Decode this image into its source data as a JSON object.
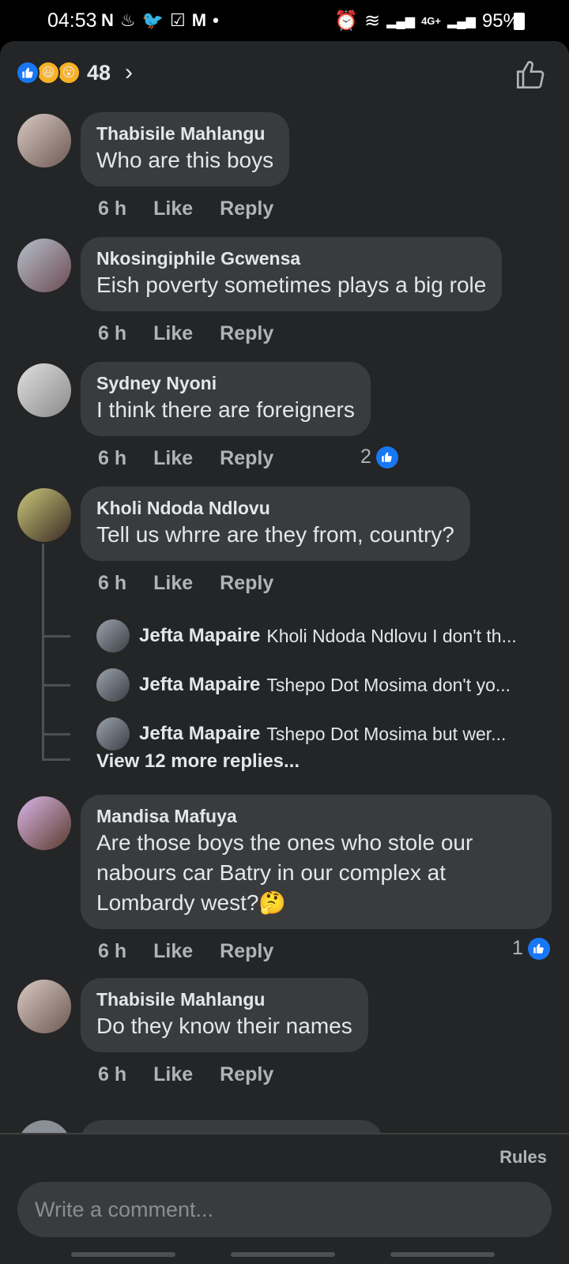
{
  "status_bar": {
    "time": "04:53",
    "left_icons": [
      "n-app-icon",
      "bell-icon",
      "twitter-icon",
      "check-icon",
      "gmail-icon",
      "dot-icon"
    ],
    "network": "4G+",
    "battery": "95%"
  },
  "reactions": {
    "types": [
      "like",
      "haha",
      "wow"
    ],
    "count": "48"
  },
  "comments": [
    {
      "author": "Thabisile Mahlangu",
      "text": "Who are this boys",
      "time": "6 h",
      "like": "Like",
      "reply": "Reply",
      "avatar_color": "#b79a8c"
    },
    {
      "author": "Nkosingiphile Gcwensa",
      "text": "Eish poverty sometimes plays a big role",
      "time": "6 h",
      "like": "Like",
      "reply": "Reply",
      "avatar_color": "#9aa4b5"
    },
    {
      "author": "Sydney Nyoni",
      "text": "I think there are foreigners",
      "time": "6 h",
      "like": "Like",
      "reply": "Reply",
      "reaction_count": "2",
      "avatar_color": "#c9c9c9"
    },
    {
      "author": "Kholi Ndoda Ndlovu",
      "text": "Tell us whrre are they from, country?",
      "time": "6 h",
      "like": "Like",
      "reply": "Reply",
      "avatar_color": "#7e8a4f"
    },
    {
      "author": "Mandisa Mafuya",
      "text": "Are those boys the ones who stole our nabours car Batry in our complex at Lombardy west?🤔",
      "time": "6 h",
      "like": "Like",
      "reply": "Reply",
      "reaction_count": "1",
      "avatar_color": "#b98fd1"
    },
    {
      "author": "Thabisile Mahlangu",
      "text": "Do they know their names",
      "time": "6 h",
      "like": "Like",
      "reply": "Reply",
      "avatar_color": "#b79a8c"
    }
  ],
  "replies": [
    {
      "author": "Jefta Mapaire",
      "text": "Kholi Ndoda Ndlovu I don't th..."
    },
    {
      "author": "Jefta Mapaire",
      "text": "Tshepo Dot Mosima don't yo..."
    },
    {
      "author": "Jefta Mapaire",
      "text": "Tshepo Dot Mosima but wer..."
    }
  ],
  "view_more_replies": "View 12 more replies...",
  "footer": {
    "rules": "Rules",
    "input_placeholder": "Write a comment..."
  },
  "colors": {
    "background": "#242526",
    "bubble": "#3a3b3c",
    "accent": "#1877f2",
    "secondary_text": "#b0b3b8"
  }
}
